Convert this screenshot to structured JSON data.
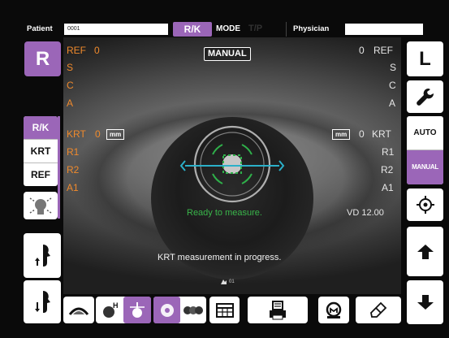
{
  "topbar": {
    "patient_label": "Patient",
    "patient_value": "0001",
    "mode_rk": "R/K",
    "mode_label": "MODE",
    "mode_tp": "T/P",
    "physician_label": "Physician",
    "physician_value": ""
  },
  "left_panel": {
    "eye_button": "R",
    "mode_items": [
      "R/K",
      "KRT",
      "REF"
    ]
  },
  "right_panel": {
    "eye_button": "L",
    "auto_label": "AUTO",
    "manual_label": "MANUAL"
  },
  "overlay": {
    "manual_tag": "MANUAL",
    "left": {
      "ref_label": "REF",
      "ref_value": "0",
      "s_label": "S",
      "c_label": "C",
      "a_label": "A",
      "krt_label": "KRT",
      "krt_value": "0",
      "unit": "mm",
      "r1_label": "R1",
      "r2_label": "R2",
      "a1_label": "A1"
    },
    "right": {
      "ref_label": "REF",
      "ref_value": "0",
      "s_label": "S",
      "c_label": "C",
      "a_label": "A",
      "krt_label": "KRT",
      "krt_value": "0",
      "unit": "mm",
      "r1_label": "R1",
      "r2_label": "R2",
      "a1_label": "A1"
    },
    "ready_text": "Ready to measure.",
    "vd_label": "VD 12.00",
    "status_text": "KRT measurement in progress.",
    "counter": "01"
  },
  "colors": {
    "accent_purple": "#9b66b8",
    "ref_orange": "#f08a2c",
    "reticle_green": "#2fb04a",
    "reticle_cyan": "#2bb0c9",
    "ready_green": "#39b54a"
  }
}
